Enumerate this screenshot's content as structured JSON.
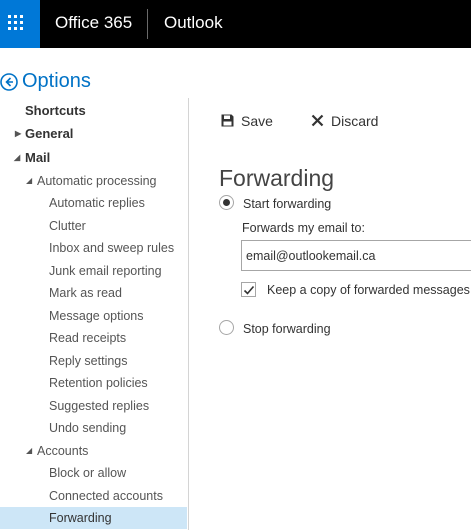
{
  "header": {
    "brand": "Office 365",
    "app": "Outlook"
  },
  "options": {
    "title": "Options"
  },
  "nav": {
    "items": [
      {
        "label": "Shortcuts"
      },
      {
        "label": "General"
      },
      {
        "label": "Mail"
      },
      {
        "label": "Automatic processing"
      },
      {
        "label": "Automatic replies"
      },
      {
        "label": "Clutter"
      },
      {
        "label": "Inbox and sweep rules"
      },
      {
        "label": "Junk email reporting"
      },
      {
        "label": "Mark as read"
      },
      {
        "label": "Message options"
      },
      {
        "label": "Read receipts"
      },
      {
        "label": "Reply settings"
      },
      {
        "label": "Retention policies"
      },
      {
        "label": "Suggested replies"
      },
      {
        "label": "Undo sending"
      },
      {
        "label": "Accounts"
      },
      {
        "label": "Block or allow"
      },
      {
        "label": "Connected accounts"
      },
      {
        "label": "Forwarding",
        "selected": true
      }
    ]
  },
  "toolbar": {
    "save_label": "Save",
    "discard_label": "Discard"
  },
  "forwarding": {
    "title": "Forwarding",
    "start_label": "Start forwarding",
    "start_selected": true,
    "field_label": "Forwards my email to:",
    "email_value": "email@outlookemail.ca",
    "keep_copy_label": "Keep a copy of forwarded messages",
    "keep_copy_checked": true,
    "stop_label": "Stop forwarding",
    "stop_selected": false
  },
  "colors": {
    "accent": "#0078d7",
    "link": "#0072c6",
    "selected_bg": "#cde6f7",
    "topbar_bg": "#000000"
  },
  "icons": {
    "launcher": "app-launcher-icon",
    "back": "back-arrow-icon",
    "save": "floppy-disk-icon",
    "discard": "close-icon",
    "checkmark": "checkmark-icon"
  }
}
